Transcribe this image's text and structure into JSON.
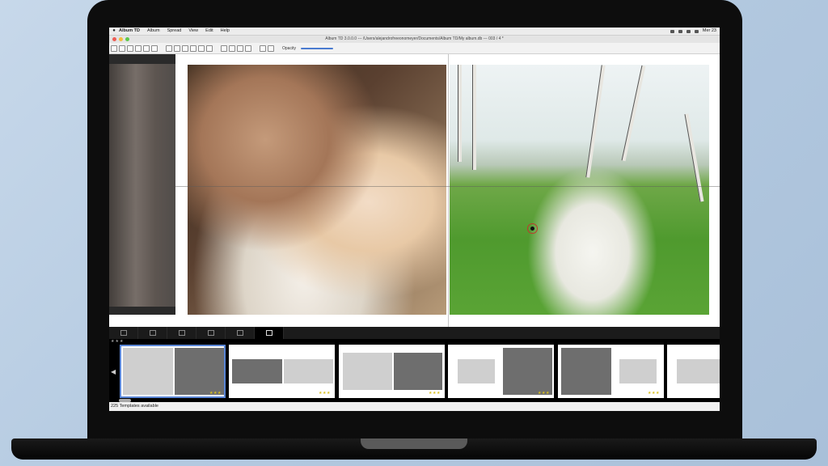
{
  "menubar": {
    "apple": "",
    "items": [
      "Album TD",
      "Album",
      "Spread",
      "View",
      "Edit",
      "Help"
    ],
    "clock": "Mer 23"
  },
  "titlebar": {
    "text": "Album TD 3.0.0.0 --- /Users/alejandrofreeonomeyer/Documents/Album TD/My album.db --- 003 / 4 *"
  },
  "toolbar": {
    "opacity_label": "Opacity"
  },
  "statusbar": {
    "text": "225 Templates available"
  },
  "colors": {
    "accent": "#4a7bd0",
    "selection": "#5a86d6",
    "star": "#d9c020",
    "frame": "#0d0d0d"
  },
  "thumbnails": [
    {
      "stars": "★★★"
    },
    {
      "stars": "★★★"
    },
    {
      "stars": "★★★"
    },
    {
      "stars": "★★★"
    },
    {
      "stars": "★★★"
    },
    {
      "stars": ""
    }
  ],
  "strip_stars": "★★★"
}
